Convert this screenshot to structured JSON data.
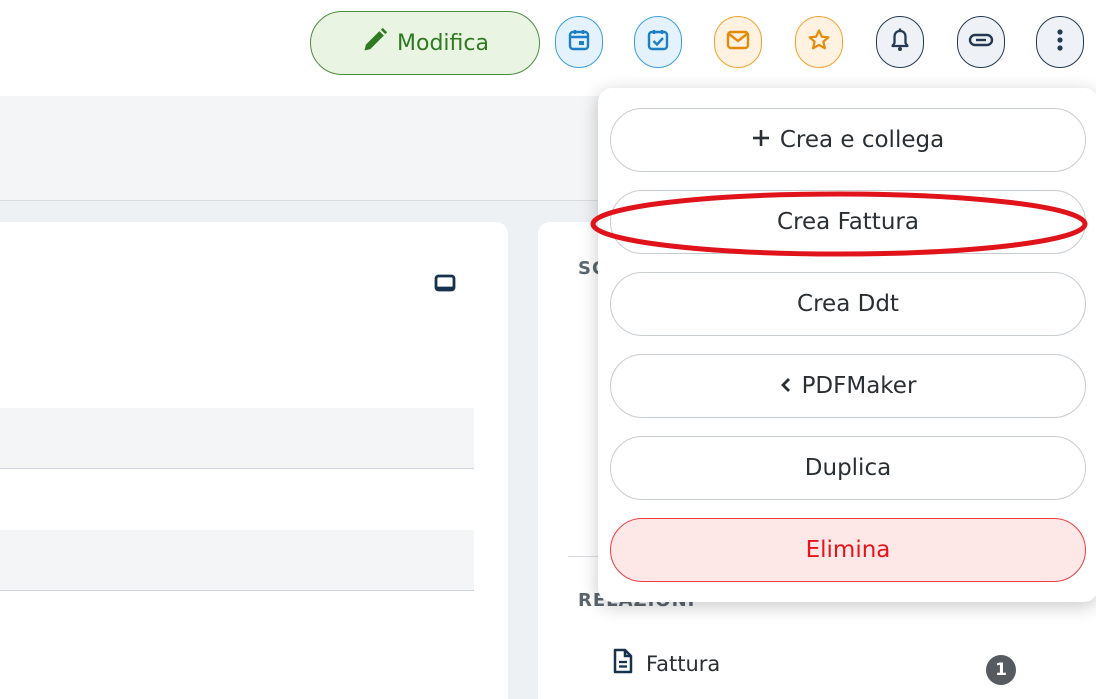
{
  "toolbar": {
    "edit_label": "Modifica",
    "icons": [
      "calendar-icon",
      "task-check-icon",
      "mail-icon",
      "star-icon",
      "bell-icon",
      "link-icon",
      "more-vertical-icon"
    ]
  },
  "colors": {
    "edit_green": "#2e7a1f",
    "blue_accent": "#3b9fe0",
    "orange_accent": "#f5a22d",
    "dark_accent": "#233a52",
    "danger_red": "#e8141b",
    "annotation_red": "#e0121a"
  },
  "dropdown": {
    "create_link_label": "Crea e collega",
    "create_invoice_label": "Crea Fattura",
    "create_ddt_label": "Crea Ddt",
    "pdfmaker_label": "PDFMaker",
    "duplicate_label": "Duplica",
    "delete_label": "Elimina"
  },
  "right_panel": {
    "section_partial_top": "SC",
    "relations_title": "RELAZIONI",
    "relation_item_label": "Fattura",
    "relation_item_count": "1"
  }
}
